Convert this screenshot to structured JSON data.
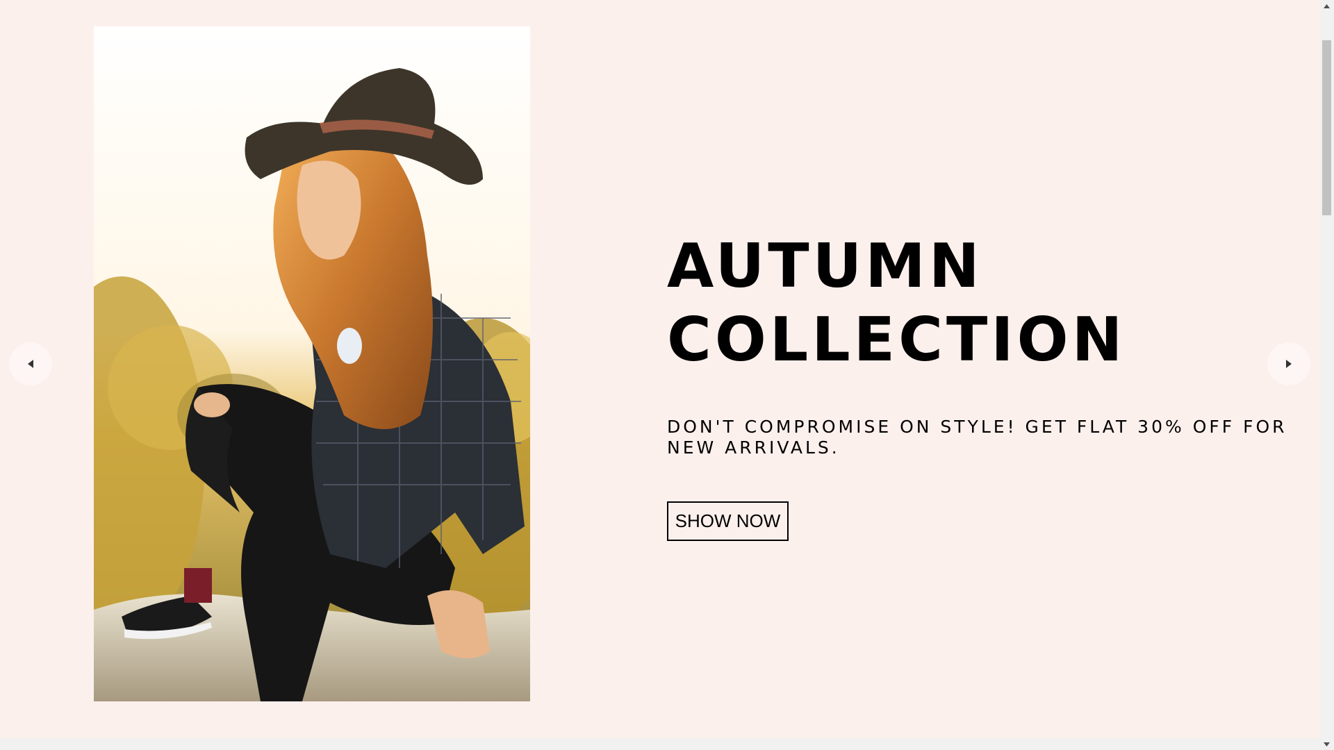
{
  "hero": {
    "image_alt": "Woman in a brown hat and plaid shirt sitting on a rock at sunset",
    "title_line1": "AUTUMN",
    "title_line2": "COLLECTION",
    "subtitle": "DON'T COMPROMISE ON STYLE! GET FLAT 30% OFF FOR NEW ARRIVALS.",
    "cta_label": "SHOW NOW"
  },
  "carousel": {
    "prev_icon": "caret-left-icon",
    "next_icon": "caret-right-icon"
  },
  "scrollbar": {
    "up_icon": "scroll-up-arrow-icon",
    "down_icon": "scroll-down-arrow-icon"
  },
  "colors": {
    "background": "#fcf0ed",
    "text": "#000000",
    "arrow_bg": "#fdf6f4"
  }
}
